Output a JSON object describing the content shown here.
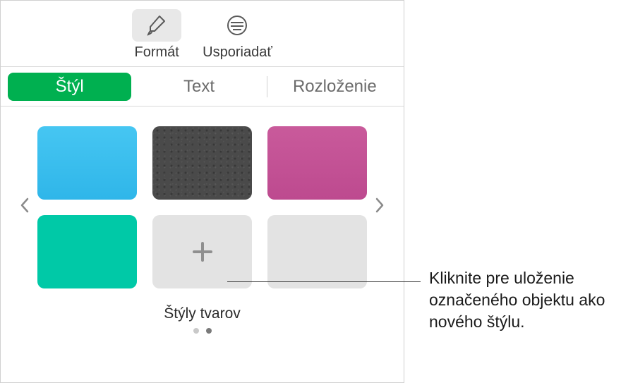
{
  "toolbar": {
    "format": {
      "label": "Formát"
    },
    "arrange": {
      "label": "Usporiadať"
    }
  },
  "tabs": {
    "style": "Štýl",
    "text": "Text",
    "layout": "Rozloženie"
  },
  "styles": {
    "caption": "Štýly tvarov"
  },
  "callout": {
    "text": "Kliknite pre uloženie označeného objektu ako nového štýlu."
  },
  "colors": {
    "accent": "#00b050"
  }
}
